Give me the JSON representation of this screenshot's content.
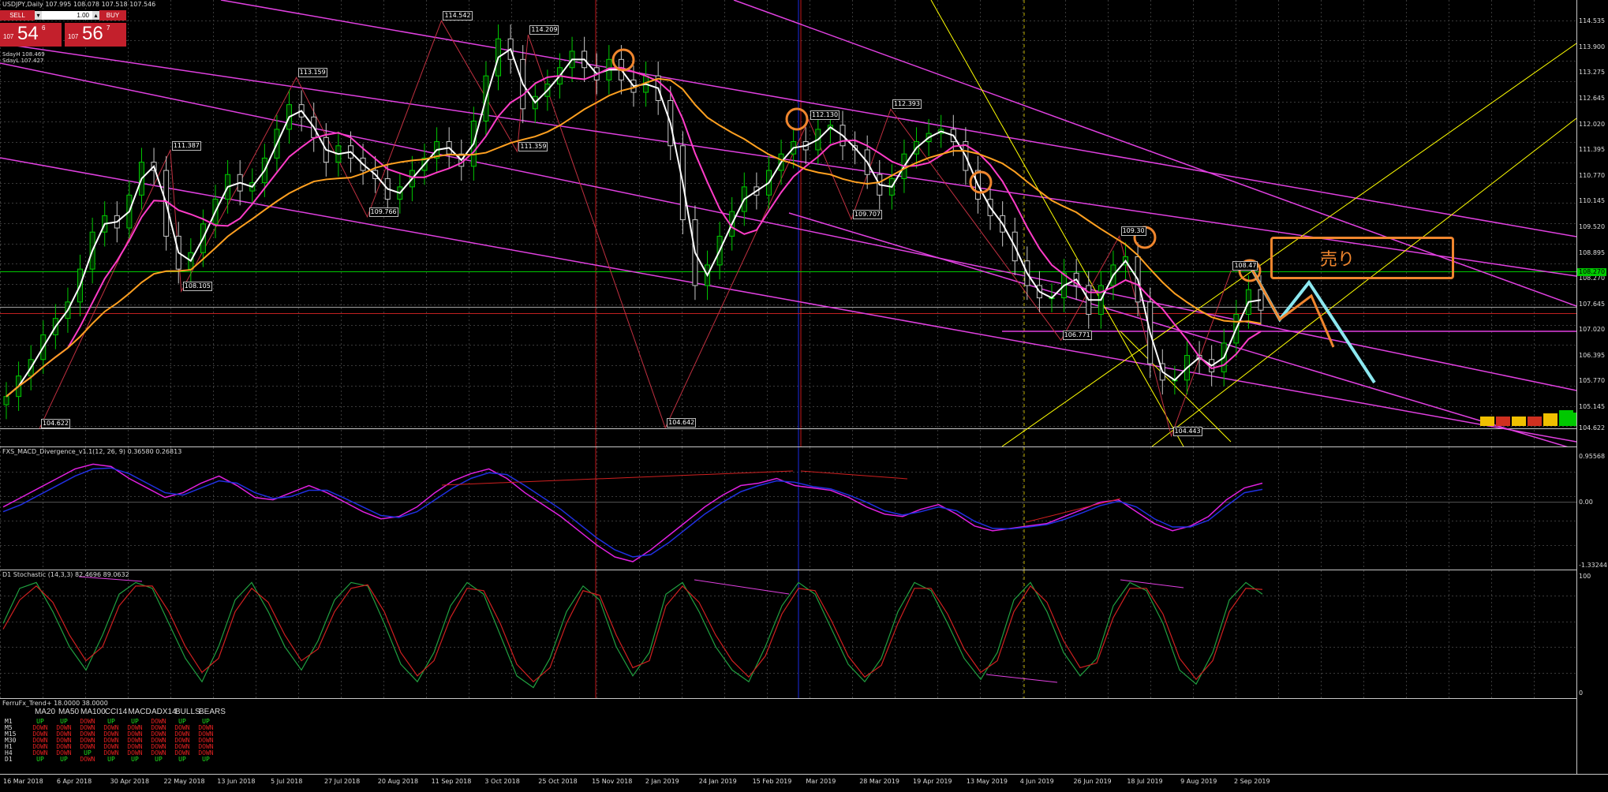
{
  "header": {
    "symbol_line": "USDJPY,Daily  107.995 108.078 107.518 107.546",
    "info1": "SdayH 108.469",
    "info2": "SdayL 107.427"
  },
  "trade_panel": {
    "sell_label": "SELL",
    "buy_label": "BUY",
    "lot": "1.00",
    "sell_price_small": "107",
    "sell_price_big": "54",
    "sell_price_sup": "6",
    "buy_price_small": "107",
    "buy_price_big": "56",
    "buy_price_sup": "7"
  },
  "annotation": {
    "sell_text": "売り"
  },
  "colors": {
    "bull": "#00c800",
    "ma_white": "#ffffff",
    "ma_magenta": "#ff3cc8",
    "ma_orange": "#ffa020",
    "trendline": "#e040e0",
    "yellow": "#ffff00",
    "annot_orange": "#f0862e",
    "annot_cyan": "#8ce8f0"
  },
  "chart_data": [
    {
      "type": "line",
      "title": "USDJPY,Daily",
      "price_axis_ticks": [
        "114.535",
        "113.900",
        "113.275",
        "112.645",
        "112.020",
        "111.395",
        "110.770",
        "110.145",
        "109.520",
        "108.895",
        "108.270",
        "107.645",
        "107.020",
        "106.395",
        "105.770",
        "105.145",
        "104.622"
      ],
      "ylim": [
        104.3,
        114.7
      ],
      "x_labels": [
        "16 Mar 2018",
        "6 Apr 2018",
        "30 Apr 2018",
        "22 May 2018",
        "13 Jun 2018",
        "5 Jul 2018",
        "27 Jul 2018",
        "20 Aug 2018",
        "11 Sep 2018",
        "3 Oct 2018",
        "25 Oct 2018",
        "15 Nov 2018",
        "2 Jan 2019",
        "24 Jan 2019",
        "15 Feb 2019",
        "Mar 2019",
        "28 Mar 2019",
        "19 Apr 2019",
        "13 May 2019",
        "4 Jun 2019",
        "26 Jun 2019",
        "18 Jul 2019",
        "9 Aug 2019",
        "2 Sep 2019"
      ],
      "swing_labels": [
        {
          "label": "104.622",
          "x": 0.015,
          "y": 104.62
        },
        {
          "label": "111.387",
          "x": 0.098,
          "y": 111.39
        },
        {
          "label": "108.105",
          "x": 0.105,
          "y": 107.96
        },
        {
          "label": "113.159",
          "x": 0.178,
          "y": 113.16
        },
        {
          "label": "109.766",
          "x": 0.223,
          "y": 109.77
        },
        {
          "label": "114.542",
          "x": 0.27,
          "y": 114.54
        },
        {
          "label": "111.359",
          "x": 0.318,
          "y": 111.36
        },
        {
          "label": "114.209",
          "x": 0.325,
          "y": 114.2
        },
        {
          "label": "104.642",
          "x": 0.412,
          "y": 104.64
        },
        {
          "label": "112.130",
          "x": 0.503,
          "y": 112.13
        },
        {
          "label": "109.707",
          "x": 0.53,
          "y": 109.71
        },
        {
          "label": "112.393",
          "x": 0.555,
          "y": 112.39
        },
        {
          "label": "106.771",
          "x": 0.663,
          "y": 106.77
        },
        {
          "label": "109.30",
          "x": 0.7,
          "y": 109.3
        },
        {
          "label": "104.443",
          "x": 0.733,
          "y": 104.44
        },
        {
          "label": "108.47",
          "x": 0.771,
          "y": 108.47
        }
      ],
      "series": [
        {
          "name": "Close",
          "values": [
            105.4,
            105.9,
            106.3,
            106.9,
            107.3,
            107.7,
            108.5,
            109.4,
            109.8,
            109.5,
            110.3,
            111.1,
            110.9,
            109.3,
            108.5,
            108.9,
            109.6,
            110.2,
            110.8,
            110.4,
            110.6,
            111.2,
            111.9,
            112.5,
            112.2,
            111.7,
            111.1,
            111.5,
            111.2,
            110.9,
            110.7,
            110.2,
            110.5,
            110.9,
            111.2,
            111.6,
            111.3,
            111.0,
            112.1,
            113.2,
            114.1,
            113.6,
            112.4,
            112.7,
            113.0,
            113.4,
            113.8,
            113.4,
            113.1,
            113.6,
            113.1,
            112.8,
            113.2,
            112.6,
            111.5,
            109.7,
            108.1,
            108.6,
            109.3,
            109.9,
            110.5,
            110.3,
            110.9,
            111.3,
            111.6,
            111.4,
            111.9,
            112.0,
            111.5,
            111.4,
            110.8,
            110.3,
            110.7,
            111.3,
            111.6,
            111.8,
            111.9,
            111.6,
            110.9,
            110.2,
            109.8,
            109.4,
            108.7,
            108.1,
            107.8,
            107.8,
            108.4,
            108.1,
            107.4,
            108.1,
            108.6,
            108.8,
            107.7,
            106.2,
            105.8,
            105.8,
            106.4,
            106.3,
            106.0,
            106.7,
            107.4,
            108.0,
            107.5
          ]
        }
      ]
    },
    {
      "type": "line",
      "title": "FXS_MACD_Divergence_v1.1(12, 26, 9) 0.36580 0.26813",
      "price_axis_ticks": [
        "0.95568",
        "0.00",
        "-1.33244"
      ],
      "ylim": [
        -1.33244,
        0.95568
      ],
      "series": [
        {
          "name": "MACD",
          "values": [
            -0.1,
            0.1,
            0.3,
            0.5,
            0.7,
            0.8,
            0.75,
            0.5,
            0.3,
            0.1,
            0.2,
            0.4,
            0.55,
            0.35,
            0.1,
            0.05,
            0.2,
            0.35,
            0.2,
            0.0,
            -0.2,
            -0.35,
            -0.3,
            -0.1,
            0.2,
            0.45,
            0.6,
            0.7,
            0.5,
            0.2,
            -0.05,
            -0.3,
            -0.6,
            -0.9,
            -1.15,
            -1.25,
            -1.0,
            -0.7,
            -0.4,
            -0.1,
            0.15,
            0.35,
            0.4,
            0.5,
            0.35,
            0.3,
            0.25,
            0.1,
            -0.1,
            -0.25,
            -0.3,
            -0.15,
            -0.05,
            -0.25,
            -0.5,
            -0.6,
            -0.55,
            -0.5,
            -0.45,
            -0.3,
            -0.15,
            0.0,
            0.05,
            -0.2,
            -0.45,
            -0.6,
            -0.5,
            -0.3,
            0.05,
            0.3,
            0.4
          ]
        },
        {
          "name": "Signal",
          "values": [
            -0.2,
            -0.05,
            0.15,
            0.35,
            0.55,
            0.7,
            0.72,
            0.6,
            0.4,
            0.2,
            0.15,
            0.3,
            0.45,
            0.4,
            0.2,
            0.08,
            0.12,
            0.25,
            0.25,
            0.08,
            -0.1,
            -0.28,
            -0.32,
            -0.2,
            0.05,
            0.3,
            0.5,
            0.62,
            0.58,
            0.35,
            0.1,
            -0.15,
            -0.45,
            -0.75,
            -1.0,
            -1.15,
            -1.1,
            -0.85,
            -0.55,
            -0.25,
            0.0,
            0.22,
            0.35,
            0.45,
            0.42,
            0.33,
            0.28,
            0.15,
            0.0,
            -0.18,
            -0.27,
            -0.2,
            -0.1,
            -0.18,
            -0.4,
            -0.55,
            -0.56,
            -0.52,
            -0.47,
            -0.36,
            -0.22,
            -0.07,
            0.02,
            -0.1,
            -0.35,
            -0.52,
            -0.52,
            -0.38,
            -0.08,
            0.2,
            0.27
          ]
        }
      ]
    },
    {
      "type": "line",
      "title": "D1 Stochastic (14,3,3) 82.4696 89.0632",
      "price_axis_ticks": [
        "100",
        "0"
      ],
      "ylim": [
        0,
        100
      ],
      "series": [
        {
          "name": "%K",
          "values": [
            60,
            90,
            95,
            70,
            40,
            20,
            50,
            85,
            95,
            90,
            60,
            30,
            10,
            40,
            80,
            95,
            70,
            40,
            20,
            45,
            80,
            95,
            92,
            60,
            25,
            10,
            35,
            75,
            95,
            85,
            50,
            15,
            5,
            30,
            70,
            92,
            80,
            40,
            15,
            35,
            85,
            95,
            70,
            40,
            20,
            10,
            40,
            75,
            95,
            85,
            55,
            25,
            10,
            30,
            70,
            95,
            88,
            60,
            30,
            12,
            35,
            80,
            95,
            70,
            35,
            15,
            30,
            75,
            95,
            88,
            60,
            20,
            8,
            35,
            80,
            95,
            85
          ]
        },
        {
          "name": "%D",
          "values": [
            55,
            80,
            92,
            78,
            50,
            28,
            40,
            75,
            92,
            92,
            70,
            40,
            18,
            30,
            70,
            90,
            78,
            50,
            28,
            38,
            70,
            90,
            93,
            70,
            35,
            15,
            28,
            65,
            90,
            88,
            60,
            25,
            10,
            22,
            60,
            88,
            84,
            50,
            22,
            28,
            75,
            92,
            78,
            50,
            28,
            14,
            32,
            68,
            90,
            88,
            62,
            32,
            14,
            24,
            60,
            90,
            90,
            68,
            38,
            18,
            28,
            70,
            92,
            78,
            45,
            22,
            26,
            65,
            90,
            90,
            68,
            30,
            12,
            28,
            70,
            90,
            89
          ]
        }
      ]
    }
  ],
  "trend_panel": {
    "title": "FerruFx_Trend+ 18.0000 38.0000",
    "headers": [
      "MA20",
      "MA50",
      "MA100",
      "CCI14",
      "MACD",
      "ADX14",
      "BULLS",
      "BEARS"
    ],
    "rows": [
      {
        "tf": "M1",
        "cells": [
          "UP",
          "UP",
          "DOWN",
          "UP",
          "UP",
          "DOWN",
          "UP",
          "UP"
        ]
      },
      {
        "tf": "M5",
        "cells": [
          "DOWN",
          "DOWN",
          "DOWN",
          "DOWN",
          "DOWN",
          "DOWN",
          "DOWN",
          "DOWN"
        ]
      },
      {
        "tf": "M15",
        "cells": [
          "DOWN",
          "DOWN",
          "DOWN",
          "DOWN",
          "DOWN",
          "DOWN",
          "DOWN",
          "DOWN"
        ]
      },
      {
        "tf": "M30",
        "cells": [
          "DOWN",
          "DOWN",
          "DOWN",
          "DOWN",
          "DOWN",
          "DOWN",
          "DOWN",
          "DOWN"
        ]
      },
      {
        "tf": "H1",
        "cells": [
          "DOWN",
          "DOWN",
          "DOWN",
          "DOWN",
          "DOWN",
          "DOWN",
          "DOWN",
          "DOWN"
        ]
      },
      {
        "tf": "H4",
        "cells": [
          "DOWN",
          "DOWN",
          "UP",
          "DOWN",
          "DOWN",
          "DOWN",
          "DOWN",
          "DOWN"
        ]
      },
      {
        "tf": "D1",
        "cells": [
          "UP",
          "UP",
          "DOWN",
          "UP",
          "UP",
          "UP",
          "UP",
          "UP"
        ]
      }
    ]
  }
}
